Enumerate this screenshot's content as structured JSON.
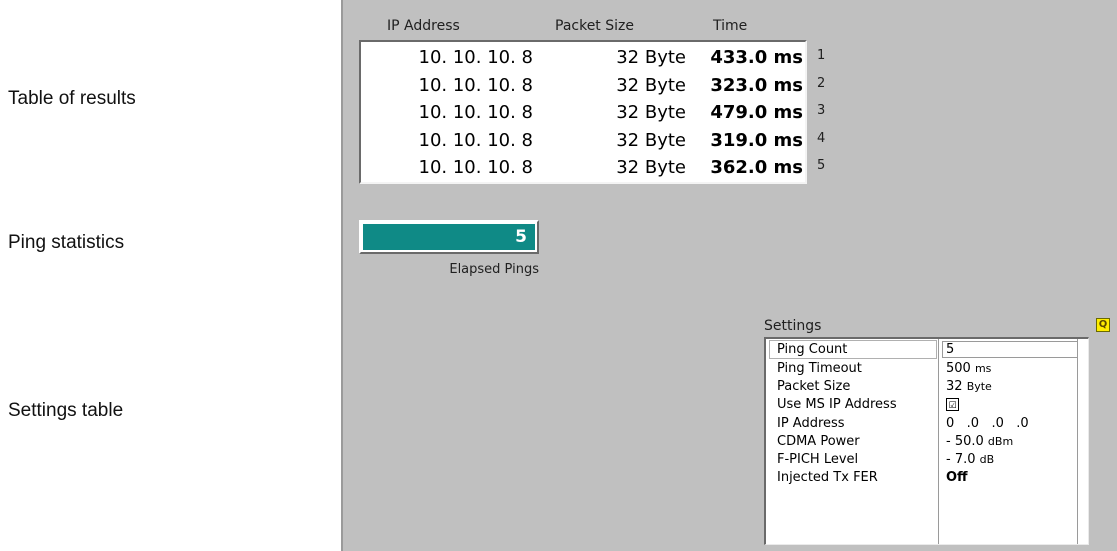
{
  "callouts": {
    "results": "Table of results",
    "statistics": "Ping statistics",
    "settings": "Settings table"
  },
  "results_table": {
    "headers": {
      "ip": "IP Address",
      "size": "Packet Size",
      "time": "Time"
    },
    "rows": [
      {
        "ip": "10. 10. 10. 8",
        "size": "32 Byte",
        "time": "433.0 ms",
        "index": "1"
      },
      {
        "ip": "10. 10. 10. 8",
        "size": "32 Byte",
        "time": "323.0 ms",
        "index": "2"
      },
      {
        "ip": "10. 10. 10. 8",
        "size": "32 Byte",
        "time": "479.0 ms",
        "index": "3"
      },
      {
        "ip": "10. 10. 10. 8",
        "size": "32 Byte",
        "time": "319.0 ms",
        "index": "4"
      },
      {
        "ip": "10. 10. 10. 8",
        "size": "32 Byte",
        "time": "362.0 ms",
        "index": "5"
      }
    ]
  },
  "statistics": {
    "elapsed_value": "5",
    "elapsed_label": "Elapsed Pings",
    "fill_color": "#0f8a86"
  },
  "settings": {
    "title": "Settings",
    "badge_glyph": "Q",
    "badge_color": "#ffee00",
    "rows": [
      {
        "label": "Ping Count",
        "value": "5",
        "unit": ""
      },
      {
        "label": "Ping Timeout",
        "value": "500",
        "unit": "ms"
      },
      {
        "label": "Packet Size",
        "value": "32",
        "unit": "Byte"
      },
      {
        "label": "Use MS IP Address",
        "checked": true,
        "check_glyph": "☑"
      },
      {
        "label": "IP Address",
        "value": "0   .0   .0   .0",
        "unit": ""
      },
      {
        "label": "CDMA Power",
        "value": "- 50.0",
        "unit": "dBm"
      },
      {
        "label": "F-PICH Level",
        "value": "- 7.0",
        "unit": "dB"
      },
      {
        "label": "Injected Tx FER",
        "value": "Off",
        "unit": ""
      }
    ]
  }
}
